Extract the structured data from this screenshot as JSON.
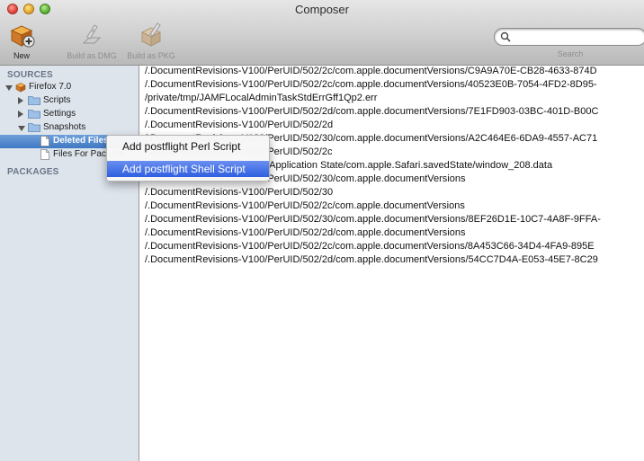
{
  "window": {
    "title": "Composer"
  },
  "toolbar": {
    "new": {
      "label": "New",
      "icon": "package-plus-icon"
    },
    "build_dmg": {
      "label": "Build as DMG",
      "icon": "dmg-icon"
    },
    "build_pkg": {
      "label": "Build as PKG",
      "icon": "pkg-icon"
    },
    "search": {
      "label": "Search",
      "value": "",
      "placeholder": ""
    }
  },
  "sidebar": {
    "sources_header": "SOURCES",
    "packages_header": "PACKAGES",
    "source": {
      "label": "Firefox 7.0",
      "icon": "firefox-package-icon",
      "expanded": true
    },
    "folders": [
      {
        "label": "Scripts",
        "icon": "folder-icon",
        "expanded": false
      },
      {
        "label": "Settings",
        "icon": "folder-icon",
        "expanded": false
      },
      {
        "label": "Snapshots",
        "icon": "folder-icon",
        "expanded": true
      }
    ],
    "snapshot_children": [
      {
        "label": "Deleted Files",
        "icon": "document-icon",
        "selected": true
      },
      {
        "label": "Files For Package",
        "icon": "document-icon",
        "selected": false
      }
    ]
  },
  "files": [
    "/.DocumentRevisions-V100/PerUID/502/2c/com.apple.documentVersions/C9A9A70E-CB28-4633-874D",
    "/.DocumentRevisions-V100/PerUID/502/2c/com.apple.documentVersions/40523E0B-7054-4FD2-8D95-",
    "/private/tmp/JAMFLocalAdminTaskStdErrGff1Qp2.err",
    "/.DocumentRevisions-V100/PerUID/502/2d/com.apple.documentVersions/7E1FD903-03BC-401D-B00C",
    "/.DocumentRevisions-V100/PerUID/502/2d",
    "/.DocumentRevisions-V100/PerUID/502/30/com.apple.documentVersions/A2C464E6-6DA9-4557-AC71",
    "/.DocumentRevisions-V100/PerUID/502/2c",
    "/Users/admin/Library/Saved Application State/com.apple.Safari.savedState/window_208.data",
    "/.DocumentRevisions-V100/PerUID/502/30/com.apple.documentVersions",
    "/.DocumentRevisions-V100/PerUID/502/30",
    "/.DocumentRevisions-V100/PerUID/502/2c/com.apple.documentVersions",
    "/.DocumentRevisions-V100/PerUID/502/30/com.apple.documentVersions/8EF26D1E-10C7-4A8F-9FFA-",
    "/.DocumentRevisions-V100/PerUID/502/2d/com.apple.documentVersions",
    "/.DocumentRevisions-V100/PerUID/502/2c/com.apple.documentVersions/8A453C66-34D4-4FA9-895E",
    "/.DocumentRevisions-V100/PerUID/502/2d/com.apple.documentVersions/54CC7D4A-E053-45E7-8C29"
  ],
  "context_menu": {
    "items": [
      {
        "label": "Add postflight Perl Script",
        "highlighted": false
      },
      {
        "label": "Add postflight Shell Script",
        "highlighted": true
      }
    ]
  },
  "colors": {
    "sidebar_bg": "#dde4ec",
    "selection": "#3f78c4",
    "menu_highlight": "#2f5fe0"
  }
}
